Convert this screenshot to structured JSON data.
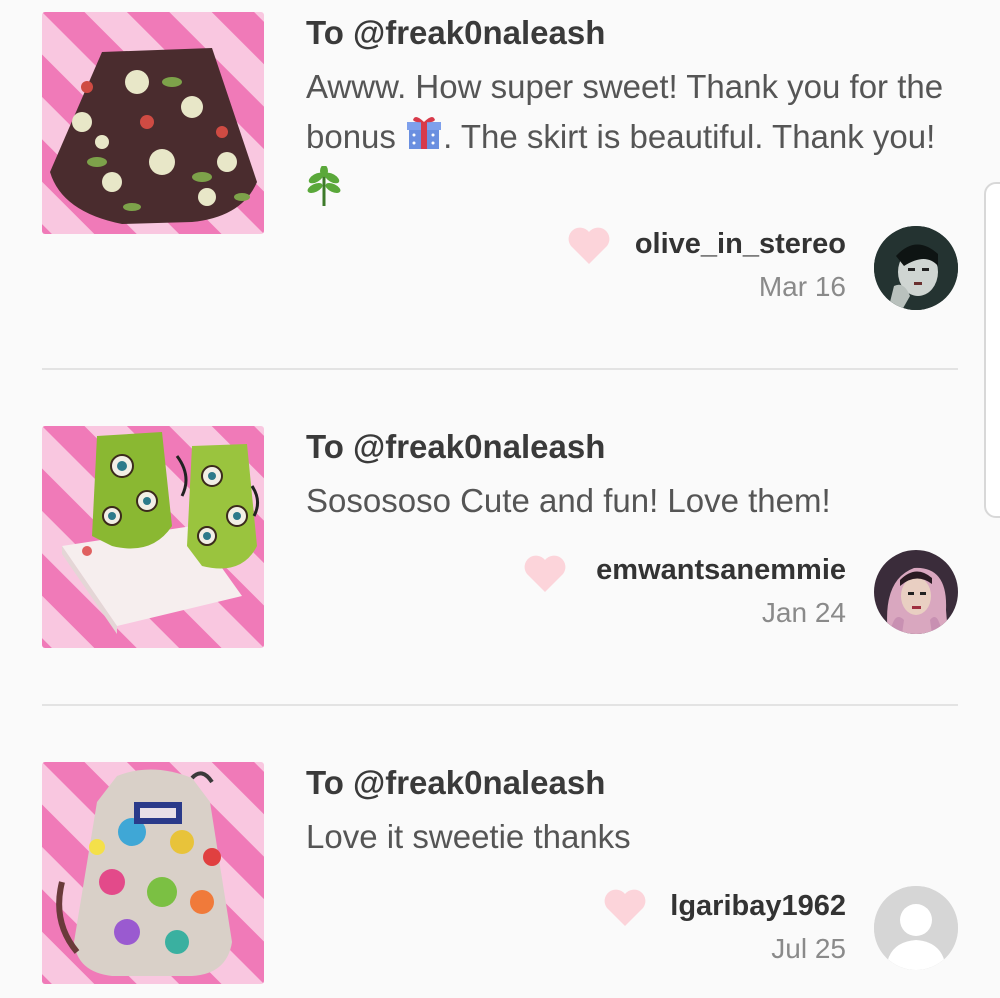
{
  "reviews": [
    {
      "to": "To @freak0naleash",
      "message_parts": [
        "Awww. How super sweet! Thank you for the bonus ",
        ". The skirt is beautiful. Thank you! "
      ],
      "user": "olive_in_stereo",
      "date": "Mar 16",
      "product": "floral skirt"
    },
    {
      "to": "To @freak0naleash",
      "message": "Sosososo Cute and fun! Love them!",
      "user": "emwantsanemmie",
      "date": "Jan 24",
      "product": "eyeball print boots"
    },
    {
      "to": "To @freak0naleash",
      "message": "Love it sweetie thanks",
      "user": "lgaribay1962",
      "date": "Jul 25",
      "product": "printed backpack"
    }
  ],
  "colors": {
    "heart": "#fcd4da",
    "divider": "#e3e3e3",
    "pink_stripe": "#f07ab8",
    "background": "#fafafa"
  },
  "icons": [
    "heart-icon",
    "gift-emoji",
    "herb-emoji",
    "default-avatar-icon"
  ]
}
